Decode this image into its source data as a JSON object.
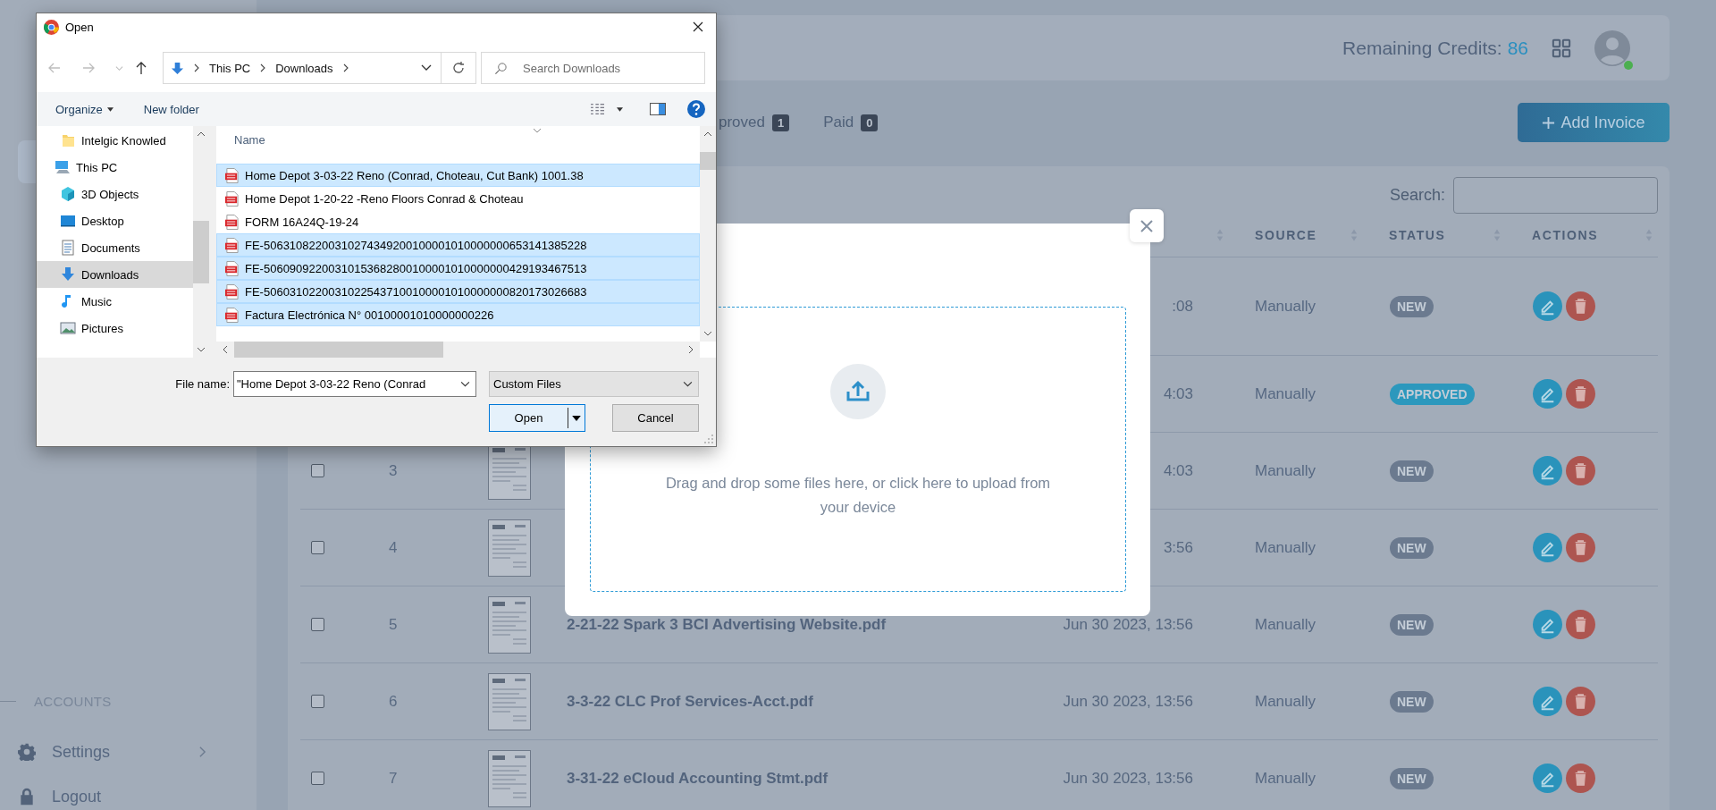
{
  "sidebar": {
    "section_label": "ACCOUNTS",
    "items": [
      {
        "label": "Settings",
        "kind": "gear",
        "expandable": true
      },
      {
        "label": "Logout",
        "kind": "lock",
        "expandable": false
      }
    ]
  },
  "header": {
    "credits_label": "Remaining Credits:",
    "credits_value": "86",
    "user_online": true
  },
  "tabs": [
    {
      "label": "proved",
      "count": "1"
    },
    {
      "label": "Paid",
      "count": "0"
    }
  ],
  "add_button": "Add Invoice",
  "table": {
    "search_label": "Search:",
    "columns": [
      {
        "label": "SOURCE"
      },
      {
        "label": "STATUS"
      },
      {
        "label": "ACTIONS"
      }
    ],
    "rows": [
      {
        "date": ":08",
        "source": "Manually",
        "status": "NEW",
        "color": "#6b7a8f"
      },
      {
        "date": "4:03",
        "source": "Manually",
        "status": "APPROVED",
        "color": "#2c98bd"
      },
      {
        "checked": false,
        "number": "3",
        "preview": true,
        "date": "4:03",
        "source": "Manually",
        "status": "NEW",
        "color": "#6b7a8f"
      },
      {
        "checked": false,
        "number": "4",
        "preview": true,
        "date": "3:56",
        "source": "Manually",
        "status": "NEW",
        "color": "#6b7a8f"
      },
      {
        "checked": false,
        "number": "5",
        "preview": true,
        "name": "2-21-22 Spark 3 BCI Advertising Website.pdf",
        "date": "Jun 30 2023, 13:56",
        "source": "Manually",
        "status": "NEW",
        "color": "#6b7a8f"
      },
      {
        "checked": false,
        "number": "6",
        "preview": true,
        "name": "3-3-22 CLC Prof Services-Acct.pdf",
        "date": "Jun 30 2023, 13:56",
        "source": "Manually",
        "status": "NEW",
        "color": "#6b7a8f"
      },
      {
        "checked": false,
        "number": "7",
        "preview": true,
        "name": "3-31-22 eCloud Accounting Stmt.pdf",
        "date": "Jun 30 2023, 13:56",
        "source": "Manually",
        "status": "NEW",
        "color": "#6b7a8f"
      }
    ]
  },
  "upload_modal": {
    "prompt": "Drag and drop some files here, or click here to upload from your device"
  },
  "file_dialog": {
    "title": "Open",
    "path": [
      "This PC",
      "Downloads"
    ],
    "search_placeholder": "Search Downloads",
    "toolbar": [
      "Organize",
      "New folder"
    ],
    "nav": [
      {
        "label": "Intelgic Knowled",
        "kind": "folder",
        "selected": false
      },
      {
        "label": "This PC",
        "kind": "pc",
        "selected": false,
        "children": [
          {
            "label": "3D Objects",
            "kind": "cube",
            "selected": false
          },
          {
            "label": "Desktop",
            "kind": "desktop",
            "selected": false
          },
          {
            "label": "Documents",
            "kind": "documents",
            "selected": false
          },
          {
            "label": "Downloads",
            "kind": "downloads",
            "selected": true
          },
          {
            "label": "Music",
            "kind": "music",
            "selected": false
          },
          {
            "label": "Pictures",
            "kind": "pictures",
            "selected": false
          }
        ]
      }
    ],
    "column": "Name",
    "files": [
      {
        "name": "Home Depot 3-03-22 Reno (Conrad, Choteau, Cut Bank) 1001.38",
        "selected": true
      },
      {
        "name": "Home Depot 1-20-22 -Reno Floors Conrad & Choteau",
        "selected": false
      },
      {
        "name": "FORM 16A24Q-19-24",
        "selected": false
      },
      {
        "name": "FE-50631082200310274349200100001010000000653141385228",
        "selected": true
      },
      {
        "name": "FE-50609092200310153682800100001010000000429193467513",
        "selected": true
      },
      {
        "name": "FE-50603102200310225437100100001010000000820173026683",
        "selected": true
      },
      {
        "name": "Factura Electrónica N° 00100001010000000226",
        "selected": true
      }
    ],
    "file_name_label": "File name:",
    "file_name_value": "\"Home Depot 3-03-22 Reno (Conrad",
    "filter": "Custom Files",
    "open_button": "Open",
    "cancel_button": "Cancel"
  }
}
